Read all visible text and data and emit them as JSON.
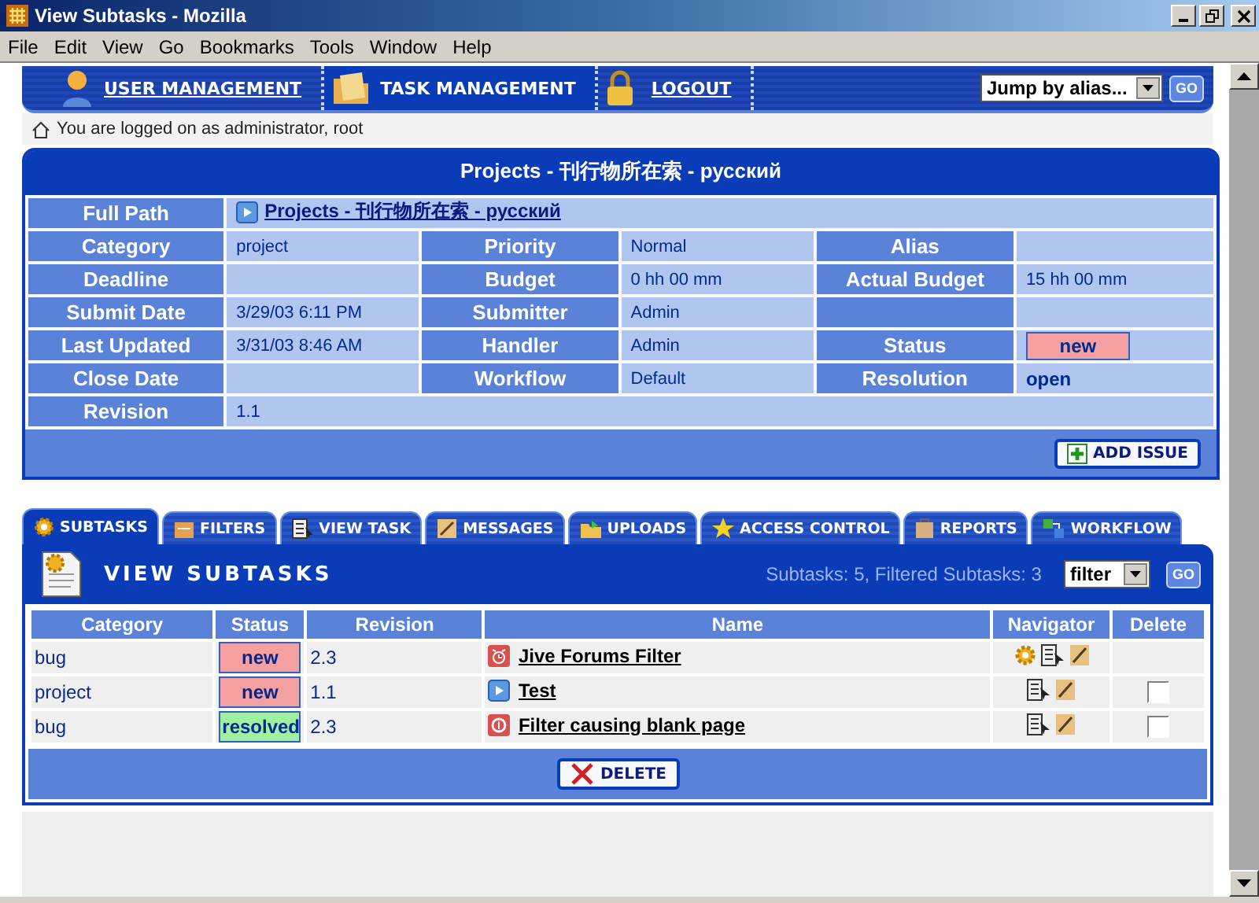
{
  "window": {
    "title": "View Subtasks - Mozilla"
  },
  "menu": [
    "File",
    "Edit",
    "View",
    "Go",
    "Bookmarks",
    "Tools",
    "Window",
    "Help"
  ],
  "nav": {
    "items": [
      {
        "label": "USER MANAGEMENT",
        "selected": false
      },
      {
        "label": "TASK MANAGEMENT",
        "selected": true
      },
      {
        "label": "LOGOUT",
        "selected": false
      }
    ],
    "jump": {
      "value": "Jump by alias...",
      "button": "GO"
    }
  },
  "login_note": "You are logged on as administrator, root",
  "project": {
    "title": "Projects - 刊行物所在索 - русский",
    "full_path": {
      "label": "Full Path",
      "value": "Projects - 刊行物所在索 - русский"
    },
    "rows": [
      [
        {
          "kind": "text",
          "label": "Category",
          "value": "project"
        },
        {
          "kind": "text",
          "label": "Priority",
          "value": "Normal"
        },
        {
          "kind": "text",
          "label": "Alias"
        }
      ],
      [
        {
          "kind": "text",
          "label": "Deadline"
        },
        {
          "kind": "text",
          "label": "Budget",
          "value": "0 hh 00 mm"
        },
        {
          "kind": "text",
          "label": "Actual Budget",
          "value": "15 hh 00 mm"
        }
      ],
      [
        {
          "kind": "text",
          "label": "Submit Date",
          "value": "3/29/03 6:11 PM"
        },
        {
          "kind": "text",
          "label": "Submitter",
          "value": "Admin"
        },
        {
          "kind": "blank"
        }
      ],
      [
        {
          "kind": "text",
          "label": "Last Updated",
          "value": "3/31/03 8:46 AM"
        },
        {
          "kind": "text",
          "label": "Handler",
          "value": "Admin"
        },
        {
          "kind": "badge",
          "label": "Status",
          "value": "new",
          "color": "#f4a0a0"
        }
      ],
      [
        {
          "kind": "text",
          "label": "Close Date"
        },
        {
          "kind": "text",
          "label": "Workflow",
          "value": "Default"
        },
        {
          "kind": "bold",
          "label": "Resolution",
          "value": "open"
        }
      ]
    ],
    "revision": {
      "label": "Revision",
      "value": "1.1"
    },
    "button": "ADD ISSUE"
  },
  "tabs": [
    {
      "label": "SUBTASKS",
      "selected": true
    },
    {
      "label": "FILTERS",
      "selected": false
    },
    {
      "label": "VIEW TASK",
      "selected": false
    },
    {
      "label": "MESSAGES",
      "selected": false
    },
    {
      "label": "UPLOADS",
      "selected": false
    },
    {
      "label": "ACCESS CONTROL",
      "selected": false
    },
    {
      "label": "REPORTS",
      "selected": false
    },
    {
      "label": "WORKFLOW",
      "selected": false
    }
  ],
  "subtasks": {
    "title": "VIEW SUBTASKS",
    "summary": "Subtasks: 5, Filtered Subtasks: 3",
    "filter": {
      "value": "filter",
      "button": "GO"
    },
    "columns": [
      "Category",
      "Status",
      "Revision",
      "Name",
      "Navigator",
      "Delete"
    ],
    "rows": [
      {
        "category": "bug",
        "status": "new",
        "color": "#f4a0a0",
        "revision": "2.3",
        "name": "Jive Forums Filter",
        "workflow_action": true,
        "deletable": false
      },
      {
        "category": "project",
        "status": "new",
        "color": "#f4a0a0",
        "revision": "1.1",
        "name": "Test",
        "workflow_action": false,
        "deletable": true,
        "checked": false
      },
      {
        "category": "bug",
        "status": "resolved",
        "color": "#a0f0a0",
        "revision": "2.3",
        "name": "Filter causing blank page",
        "workflow_action": false,
        "deletable": true,
        "checked": false
      }
    ],
    "button": "DELETE"
  }
}
